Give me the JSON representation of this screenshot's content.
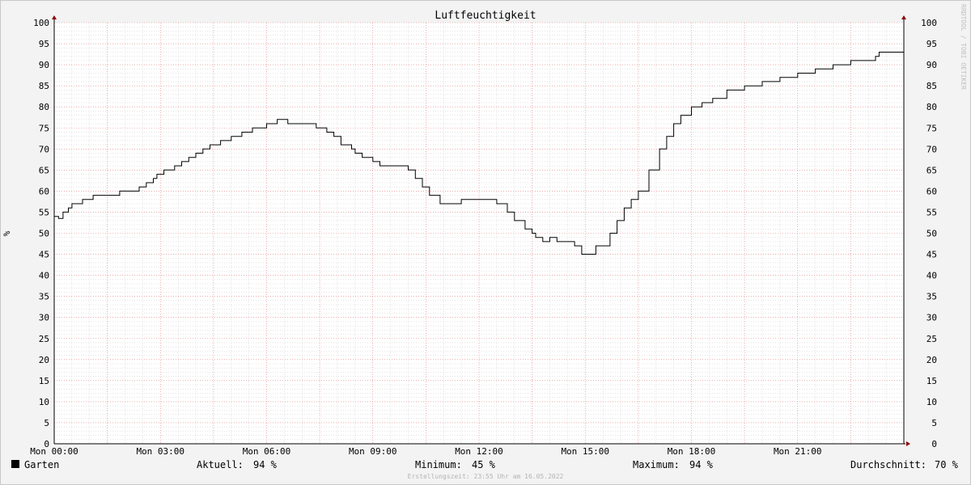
{
  "chart_data": {
    "type": "line",
    "title": "Luftfeuchtigkeit",
    "ylabel": "%",
    "ylim": [
      0,
      100
    ],
    "y_tick_labels": [
      "0",
      "5",
      "10",
      "15",
      "20",
      "25",
      "30",
      "35",
      "40",
      "45",
      "50",
      "55",
      "60",
      "65",
      "70",
      "75",
      "80",
      "85",
      "90",
      "95",
      "100"
    ],
    "x_tick_labels": [
      "Mon 00:00",
      "Mon 03:00",
      "Mon 06:00",
      "Mon 09:00",
      "Mon 12:00",
      "Mon 15:00",
      "Mon 18:00",
      "Mon 21:00"
    ],
    "x_ticks_hours": [
      0,
      3,
      6,
      9,
      12,
      15,
      18,
      21
    ],
    "xlim_hours": [
      0,
      24
    ],
    "grid": true,
    "colors": {
      "background": "#f3f3f3",
      "plot_area": "#ffffff",
      "minor_grid": "#c8c8c8",
      "major_grid": "#e07a7a",
      "axis": "#000000",
      "arrow": "#8b0000",
      "line": "#000000"
    },
    "series": [
      {
        "name": "Garten",
        "x_hours": [
          0.0,
          0.12,
          0.25,
          0.4,
          0.5,
          0.8,
          1.1,
          1.8,
          1.85,
          2.3,
          2.4,
          2.6,
          2.8,
          2.9,
          3.1,
          3.4,
          3.6,
          3.8,
          4.0,
          4.2,
          4.4,
          4.7,
          5.0,
          5.3,
          5.6,
          6.0,
          6.3,
          6.6,
          7.0,
          7.4,
          7.7,
          7.9,
          8.1,
          8.4,
          8.5,
          8.7,
          9.0,
          9.2,
          9.8,
          10.0,
          10.2,
          10.4,
          10.6,
          10.9,
          11.4,
          11.5,
          11.8,
          12.3,
          12.5,
          12.8,
          13.0,
          13.3,
          13.5,
          13.6,
          13.8,
          14.0,
          14.2,
          14.5,
          14.7,
          14.9,
          15.1,
          15.3,
          15.5,
          15.7,
          15.9,
          16.1,
          16.3,
          16.5,
          16.8,
          17.1,
          17.3,
          17.5,
          17.7,
          18.0,
          18.3,
          18.6,
          19.0,
          19.5,
          20.0,
          20.5,
          21.0,
          21.5,
          22.0,
          22.5,
          23.2,
          23.3,
          24.0
        ],
        "y": [
          54,
          53.5,
          55,
          56,
          57,
          58,
          59,
          59,
          60,
          60,
          61,
          62,
          63,
          64,
          65,
          66,
          67,
          68,
          69,
          70,
          71,
          72,
          73,
          74,
          75,
          76,
          77,
          76,
          76,
          75,
          74,
          73,
          71,
          70,
          69,
          68,
          67,
          66,
          66,
          65,
          63,
          61,
          59,
          57,
          57,
          58,
          58,
          58,
          57,
          55,
          53,
          51,
          50,
          49,
          48,
          49,
          48,
          48,
          47,
          45,
          45,
          47,
          47,
          50,
          53,
          56,
          58,
          60,
          65,
          70,
          73,
          76,
          78,
          80,
          81,
          82,
          84,
          85,
          86,
          87,
          88,
          89,
          90,
          91,
          92,
          93,
          94
        ]
      }
    ],
    "legend": {
      "label": "Garten",
      "color": "#000000",
      "stats": [
        {
          "label": "Aktuell:",
          "value": "94 %"
        },
        {
          "label": "Minimum:",
          "value": "45 %"
        },
        {
          "label": "Maximum:",
          "value": "94 %"
        },
        {
          "label": "Durchschnitt:",
          "value": "70 %"
        }
      ]
    },
    "footer": "Erstellungszeit: 23:55 Uhr am 16.05.2022",
    "watermark": "RRDTOOL / TOBI OETIKER"
  }
}
